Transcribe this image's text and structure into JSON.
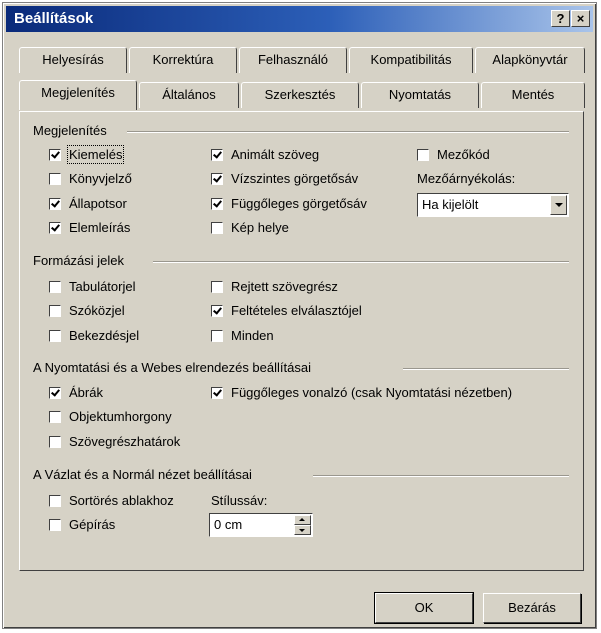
{
  "window": {
    "title": "Beállítások",
    "help_label": "?",
    "close_label": "×"
  },
  "tabs": {
    "back": [
      "Helyesírás",
      "Korrektúra",
      "Felhasználó",
      "Kompatibilitás",
      "Alapkönyvtár"
    ],
    "front": [
      "Megjelenítés",
      "Általános",
      "Szerkesztés",
      "Nyomtatás",
      "Mentés"
    ],
    "active": "Megjelenítés"
  },
  "groups": {
    "display": {
      "title": "Megjelenítés",
      "col1": [
        {
          "label": "Kiemelés",
          "checked": true
        },
        {
          "label": "Könyvjelző",
          "checked": false
        },
        {
          "label": "Állapotsor",
          "checked": true
        },
        {
          "label": "Elemleírás",
          "checked": true
        }
      ],
      "col2": [
        {
          "label": "Animált szöveg",
          "checked": true
        },
        {
          "label": "Vízszintes görgetősáv",
          "checked": true
        },
        {
          "label": "Függőleges görgetősáv",
          "checked": true
        },
        {
          "label": "Kép helye",
          "checked": false
        }
      ],
      "field_codes": {
        "label": "Mezőkód",
        "checked": false
      },
      "shading_label": "Mezőárnyékolás:",
      "shading_value": "Ha kijelölt"
    },
    "formatting": {
      "title": "Formázási jelek",
      "col1": [
        {
          "label": "Tabulátorjel",
          "checked": false
        },
        {
          "label": "Szóközjel",
          "checked": false
        },
        {
          "label": "Bekezdésjel",
          "checked": false
        }
      ],
      "col2": [
        {
          "label": "Rejtett szövegrész",
          "checked": false
        },
        {
          "label": "Feltételes elválasztójel",
          "checked": true
        },
        {
          "label": "Minden",
          "checked": false
        }
      ]
    },
    "print_web": {
      "title": "A Nyomtatási és a Webes elrendezés beállításai",
      "col1": [
        {
          "label": "Ábrák",
          "checked": true
        },
        {
          "label": "Objektumhorgony",
          "checked": false
        },
        {
          "label": "Szövegrészhatárok",
          "checked": false
        }
      ],
      "vertical_ruler": {
        "label": "Függőleges vonalzó (csak Nyomtatási nézetben)",
        "checked": true
      }
    },
    "outline_normal": {
      "title": "A Vázlat és a Normál nézet beállításai",
      "col1": [
        {
          "label": "Sortörés ablakhoz",
          "checked": false
        },
        {
          "label": "Gépírás",
          "checked": false
        }
      ],
      "style_area_label": "Stílussáv:",
      "style_area_value": "0 cm"
    }
  },
  "buttons": {
    "ok": "OK",
    "close": "Bezárás"
  }
}
